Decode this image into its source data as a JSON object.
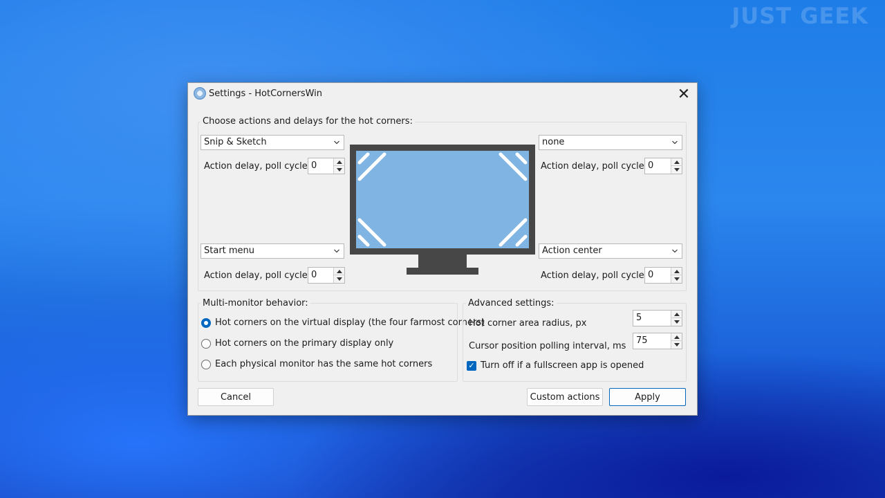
{
  "watermark": "JUST GEEK",
  "window": {
    "title": "Settings - HotCornersWin",
    "close_glyph": "✕"
  },
  "corners_group": {
    "label": "Choose actions and delays for the hot corners:",
    "delay_label": "Action delay, poll cycles:",
    "top_left": {
      "action": "Snip & Sketch",
      "delay": "0"
    },
    "top_right": {
      "action": "none",
      "delay": "0"
    },
    "bottom_left": {
      "action": "Start menu",
      "delay": "0"
    },
    "bottom_right": {
      "action": "Action center",
      "delay": "0"
    }
  },
  "multi_monitor": {
    "label": "Multi-monitor behavior:",
    "options": [
      {
        "label": "Hot corners on the virtual display (the four farmost corners)",
        "checked": true
      },
      {
        "label": "Hot corners on the primary display only",
        "checked": false
      },
      {
        "label": "Each physical monitor has the same hot corners",
        "checked": false
      }
    ]
  },
  "advanced": {
    "label": "Advanced settings:",
    "radius_label": "Hot corner area radius, px",
    "radius_value": "5",
    "polling_label": "Cursor position polling interval, ms",
    "polling_value": "75",
    "fullscreen_label": "Turn off if a fullscreen app is opened",
    "fullscreen_checked": true
  },
  "buttons": {
    "cancel": "Cancel",
    "custom_actions": "Custom actions",
    "apply": "Apply"
  },
  "colors": {
    "accent": "#0067c0",
    "monitor_frame": "#474747",
    "monitor_screen": "#7fb4e3"
  },
  "icons": {
    "app": "hotcorners-app-icon",
    "close": "close-icon",
    "dropdown": "chevron-down-icon"
  }
}
